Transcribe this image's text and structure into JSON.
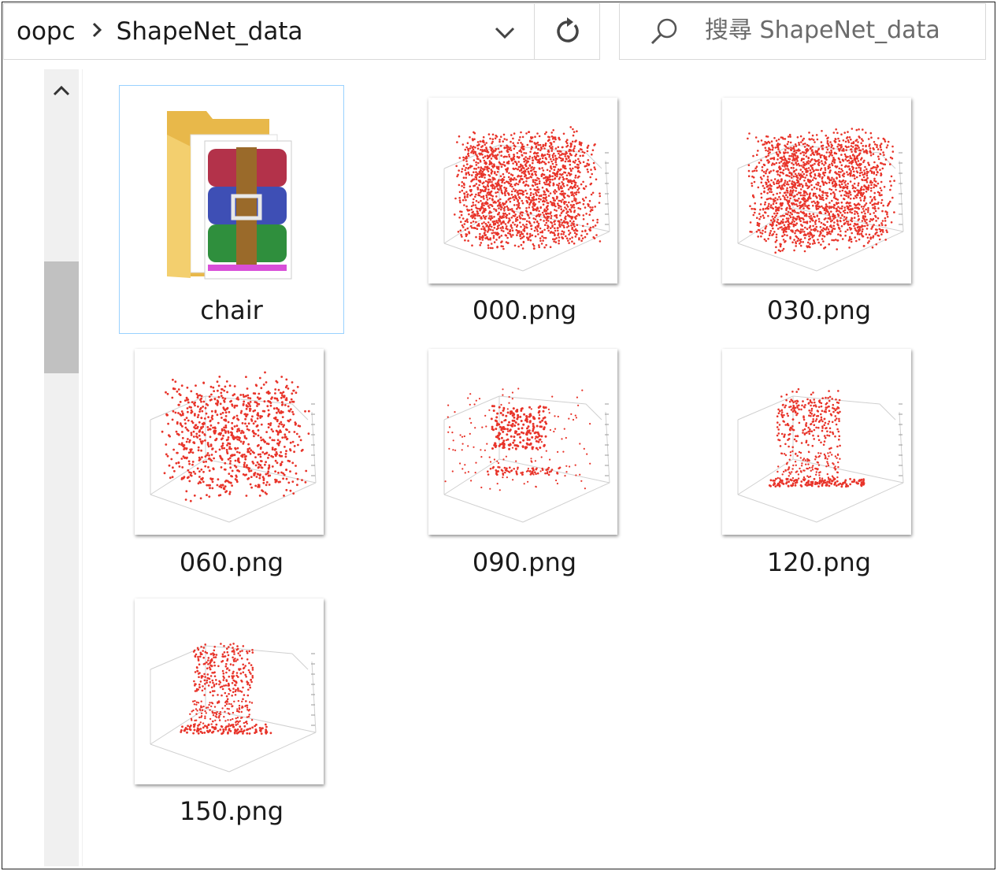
{
  "address": {
    "root": "oopc",
    "current": "ShapeNet_data"
  },
  "search": {
    "placeholder": "搜尋 ShapeNet_data"
  },
  "icons": {
    "dropdown": "chevron-down-icon",
    "refresh": "refresh-icon",
    "search": "search-icon",
    "scroll_up": "chevron-up-icon",
    "folder": "archive-folder-icon"
  },
  "items": [
    {
      "label": "chair",
      "type": "folder"
    },
    {
      "label": "000.png",
      "type": "image"
    },
    {
      "label": "030.png",
      "type": "image"
    },
    {
      "label": "060.png",
      "type": "image"
    },
    {
      "label": "090.png",
      "type": "image"
    },
    {
      "label": "120.png",
      "type": "image"
    },
    {
      "label": "150.png",
      "type": "image"
    }
  ],
  "colors": {
    "selection_border": "#99d1ff",
    "point_red": "#e8342a",
    "folder_yellow": "#f3cf6e"
  }
}
